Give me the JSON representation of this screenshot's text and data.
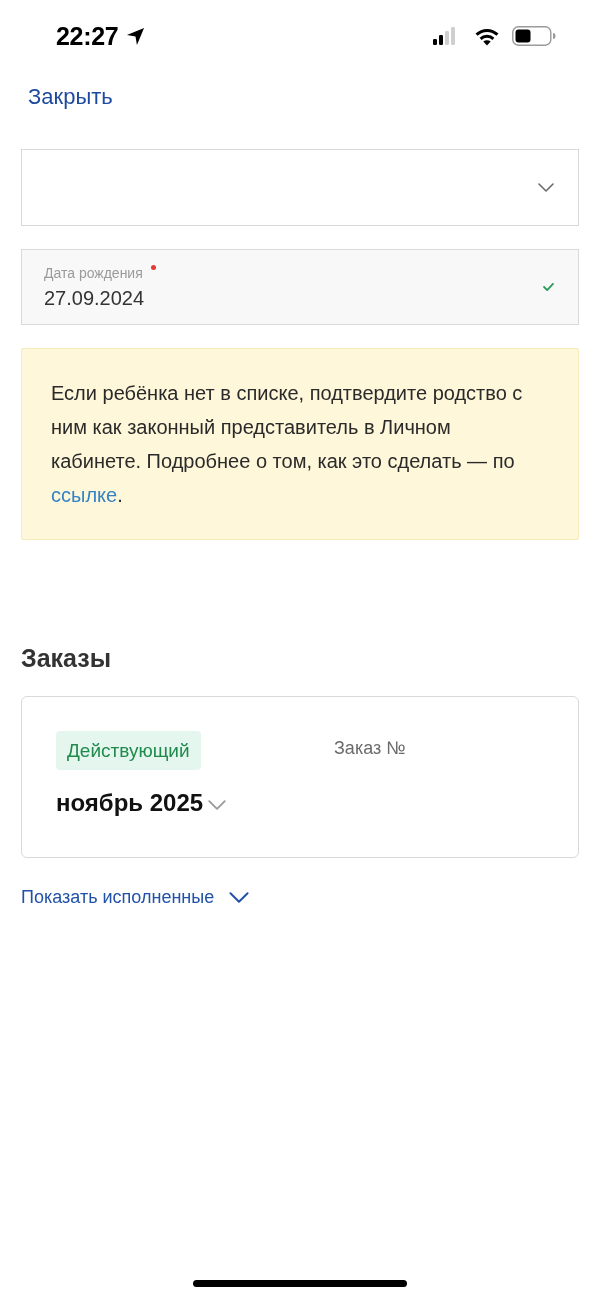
{
  "status_bar": {
    "time": "22:27"
  },
  "header": {
    "close": "Закрыть"
  },
  "fields": [
    {
      "kind": "select",
      "expanded": false
    },
    {
      "kind": "date",
      "label": "Дата рождения",
      "required": true,
      "value": "27.09.2024",
      "valid": true
    }
  ],
  "notice": {
    "text": "Если ребёнка нет в списке, подтвердите родство с ним как законный представитель в Личном кабинете. Подробнее о том, как это сделать — по",
    "link": "ссылке",
    "after_link": "."
  },
  "orders": {
    "title": "Заказы",
    "items": [
      {
        "status": "Действующий",
        "active": true,
        "number": "Заказ №",
        "period": "ноябрь 2025",
        "expanded": false
      }
    ],
    "show_completed": {
      "label": "Показать исполненные",
      "expanded": false
    }
  }
}
